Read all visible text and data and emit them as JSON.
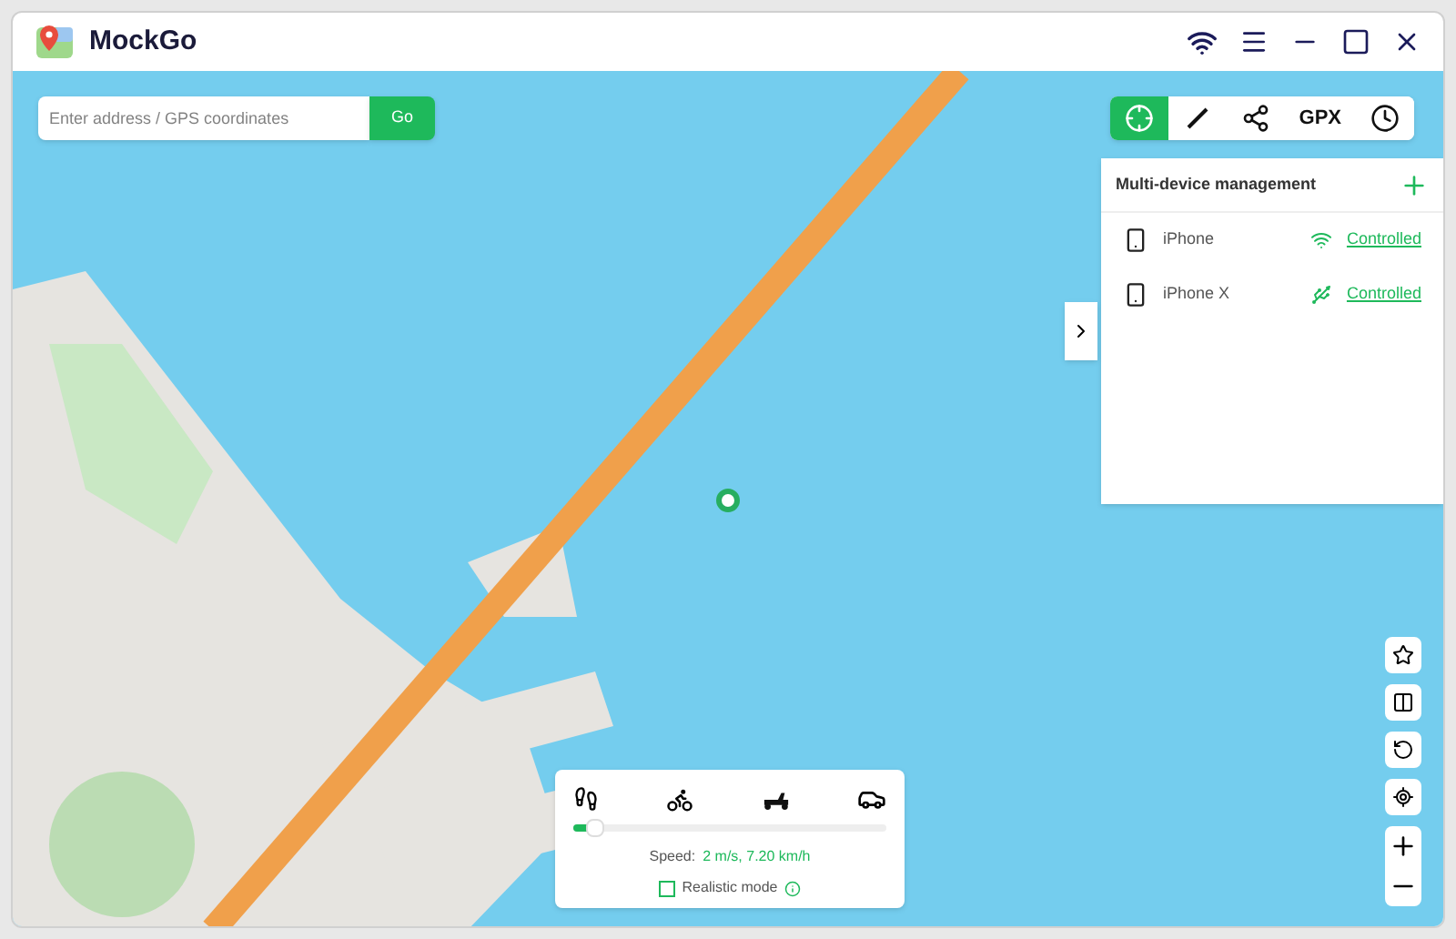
{
  "app": {
    "title": "MockGo"
  },
  "search": {
    "placeholder": "Enter address / GPS coordinates",
    "button": "Go"
  },
  "toolbar": [
    {
      "kind": "teleport",
      "selected": true
    },
    {
      "kind": "route",
      "selected": false
    },
    {
      "kind": "share",
      "selected": false
    },
    {
      "kind": "gpx",
      "label": "GPX",
      "selected": false
    },
    {
      "kind": "history",
      "selected": false
    }
  ],
  "devices": {
    "title": "Multi-device management",
    "items": [
      {
        "name": "iPhone",
        "kind": "wifi",
        "status": "Controlled"
      },
      {
        "name": "iPhone X",
        "kind": "usb",
        "status": "Controlled"
      }
    ]
  },
  "speed": {
    "level": 0.05,
    "label": "Speed:",
    "value": "2 m/s, 7.20 km/h",
    "realistic": {
      "label": "Realistic mode",
      "checked": false
    }
  }
}
